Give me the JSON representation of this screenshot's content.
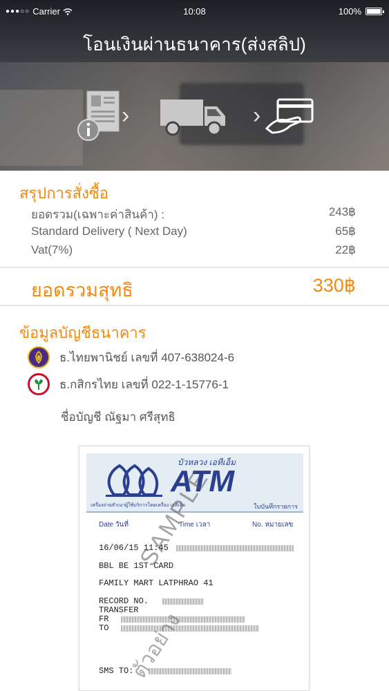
{
  "status": {
    "carrier": "Carrier",
    "time": "10:08",
    "battery": "100%"
  },
  "header": {
    "title": "โอนเงินผ่านธนาคาร(ส่งสลิป)",
    "steps": [
      "document-info-icon",
      "delivery-truck-icon",
      "card-payment-icon"
    ]
  },
  "summary": {
    "title": "สรุปการสั่งซื้อ",
    "rows": [
      {
        "label": "ยอดรวม(เฉพาะค่าสินค้า) :",
        "value": "243฿"
      },
      {
        "label": "Standard Delivery ( Next Day)",
        "value": "65฿"
      },
      {
        "label": "Vat(7%)",
        "value": "22฿"
      }
    ],
    "total_label": "ยอดรวมสุทธิ",
    "total_value": "330฿"
  },
  "bank": {
    "title": "ข้อมูลบัญชีธนาคาร",
    "accounts": [
      {
        "text": "ธ.ไทยพานิชย์ เลขที่ 407-638024-6",
        "color": "#4b2a83"
      },
      {
        "text": "ธ.กสิกรไทย เลขที่ 022-1-15776-1",
        "color": "#1e8a3a"
      }
    ],
    "account_name": "ชื่อบัญชี ณัฐมา ศรีสุทธิ"
  },
  "slip": {
    "brand_th": "บัวหลวง เอทีเอ็ม",
    "brand": "ATM",
    "small_left": "เครื่องถ่ายสำเนาผู้ใช้บริการโดยเครื่อง เอทีเอ็ม",
    "small_right": "ใบบันทึกรายการ",
    "col_date": "Date วันที่",
    "col_time": "Time เวลา",
    "col_no": "No. หมายเลข",
    "line_datetime": "16/06/15 11:45",
    "line_card": "BBL BE 1ST CARD",
    "line_location": "FAMILY MART LATPHRAO 41",
    "line_record": "RECORD NO.",
    "line_transfer": "TRANSFER",
    "line_fr": "FR",
    "line_to": "TO",
    "line_sms": "SMS TO:",
    "watermark": "SAMPLE",
    "watermark_th": "ตัวอย่าง"
  }
}
